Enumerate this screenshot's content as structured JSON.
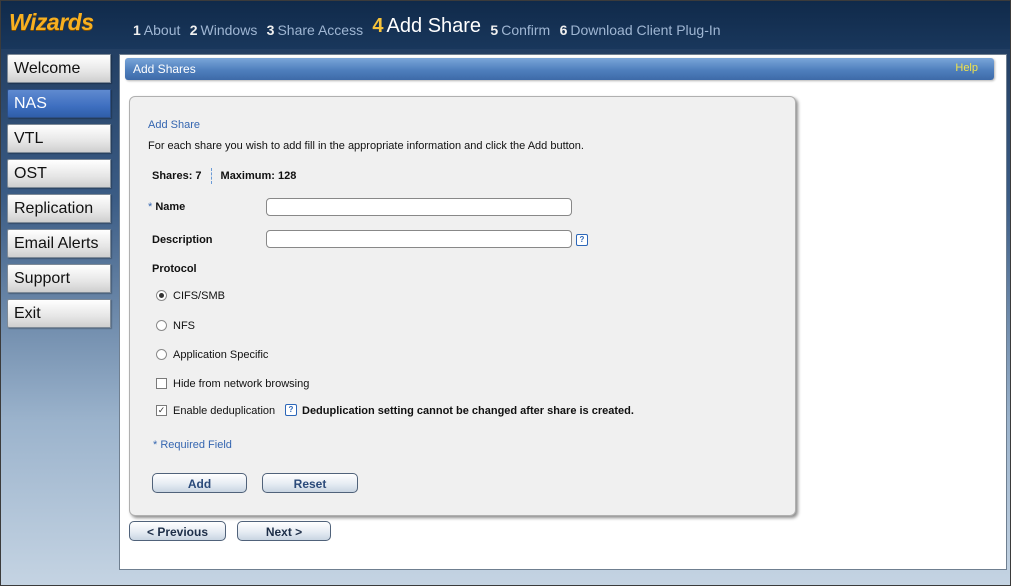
{
  "app": {
    "logo": "Wizards"
  },
  "steps": [
    {
      "num": "1",
      "label": "About"
    },
    {
      "num": "2",
      "label": "Windows"
    },
    {
      "num": "3",
      "label": "Share Access"
    },
    {
      "num": "4",
      "label": "Add Share"
    },
    {
      "num": "5",
      "label": "Confirm"
    },
    {
      "num": "6",
      "label": "Download Client Plug-In"
    }
  ],
  "sidebar": {
    "items": [
      {
        "label": "Welcome"
      },
      {
        "label": "NAS"
      },
      {
        "label": "VTL"
      },
      {
        "label": "OST"
      },
      {
        "label": "Replication"
      },
      {
        "label": "Email Alerts"
      },
      {
        "label": "Support"
      },
      {
        "label": "Exit"
      }
    ]
  },
  "header": {
    "title": "Add Shares",
    "help": "Help"
  },
  "form": {
    "section_title": "Add Share",
    "instructions": "For each share you wish to add fill in the appropriate information and click the Add button.",
    "shares_label": "Shares: 7",
    "maximum_label": "Maximum: 128",
    "name_star": "*",
    "name_label": "Name",
    "name_value": "",
    "description_label": "Description",
    "description_value": "",
    "protocol_label": "Protocol",
    "protocols": [
      "CIFS/SMB",
      "NFS",
      "Application Specific"
    ],
    "selected_protocol": "CIFS/SMB",
    "hide_label": "Hide from network browsing",
    "hide_checked": false,
    "dedup_label": "Enable deduplication",
    "dedup_checked": true,
    "dedup_warning": "Deduplication setting cannot be changed after share is created.",
    "required_note": "* Required Field",
    "add_button": "Add",
    "reset_button": "Reset"
  },
  "nav": {
    "previous": "< Previous",
    "next": "Next >"
  },
  "colors": {
    "accent": "#3566b0",
    "logo": "#f7b021",
    "active_step": "#f7c33a",
    "help": "#f2e34a"
  }
}
